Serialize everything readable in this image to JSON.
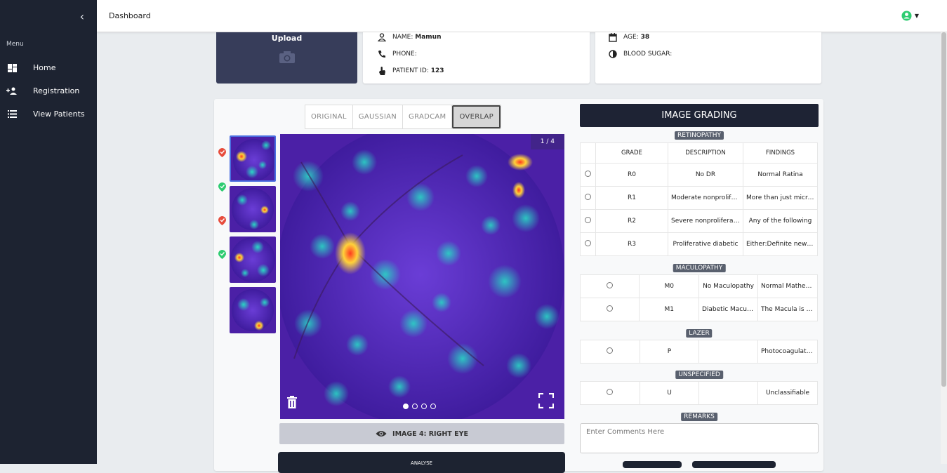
{
  "sidebar": {
    "menu_label": "Menu",
    "items": [
      {
        "label": "Home",
        "icon": "dashboard-icon"
      },
      {
        "label": "Registration",
        "icon": "person-add-icon"
      },
      {
        "label": "View Patients",
        "icon": "list-icon"
      }
    ]
  },
  "topbar": {
    "title": "Dashboard"
  },
  "upload": {
    "label": "Upload"
  },
  "patient": {
    "name_label": "NAME:",
    "name": "Mamun",
    "phone_label": "PHONE:",
    "phone": "",
    "id_label": "PATIENT ID:",
    "id": "123",
    "age_label": "AGE:",
    "age": "38",
    "sugar_label": "BLOOD SUGAR:",
    "sugar": ""
  },
  "tabs": [
    "ORIGINAL",
    "GAUSSIAN",
    "GRADCAM",
    "OVERLAP"
  ],
  "active_tab": "OVERLAP",
  "viewer": {
    "counter": "1 / 4",
    "caption": "IMAGE 4: RIGHT EYE",
    "analyse": "ANALYSE"
  },
  "thumbnails": [
    {
      "status": "flagged",
      "color": "#e74c3c"
    },
    {
      "status": "ok",
      "color": "#2ecc71"
    },
    {
      "status": "flagged",
      "color": "#e74c3c"
    },
    {
      "status": "ok",
      "color": "#2ecc71"
    }
  ],
  "grading": {
    "title": "IMAGE GRADING",
    "retinopathy": {
      "label": "RETINOPATHY",
      "headers": [
        "GRADE",
        "DESCRIPTION",
        "FINDINGS"
      ],
      "rows": [
        [
          "R0",
          "No DR",
          "Normal Ratina"
        ],
        [
          "R1",
          "Moderate nonproliferative",
          "More than just microaneurysms"
        ],
        [
          "R2",
          "Severe nonproliferative",
          "Any of the following"
        ],
        [
          "R3",
          "Proliferative diabetic",
          "Either:Definite new vessels"
        ]
      ]
    },
    "maculopathy": {
      "label": "MACULOPATHY",
      "rows": [
        [
          "M0",
          "No Maculopathy",
          "Normal Mathematics"
        ],
        [
          "M1",
          "Diabetic Maculopathy",
          "The Macula is affected"
        ]
      ]
    },
    "lazer": {
      "label": "LAZER",
      "rows": [
        [
          "P",
          "",
          "Photocoagulation"
        ]
      ]
    },
    "unspecified": {
      "label": "UNSPECIFIED",
      "rows": [
        [
          "U",
          "",
          "Unclassifiable"
        ]
      ]
    },
    "remarks": {
      "label": "REMARKS",
      "placeholder": "Enter Comments Here"
    }
  }
}
